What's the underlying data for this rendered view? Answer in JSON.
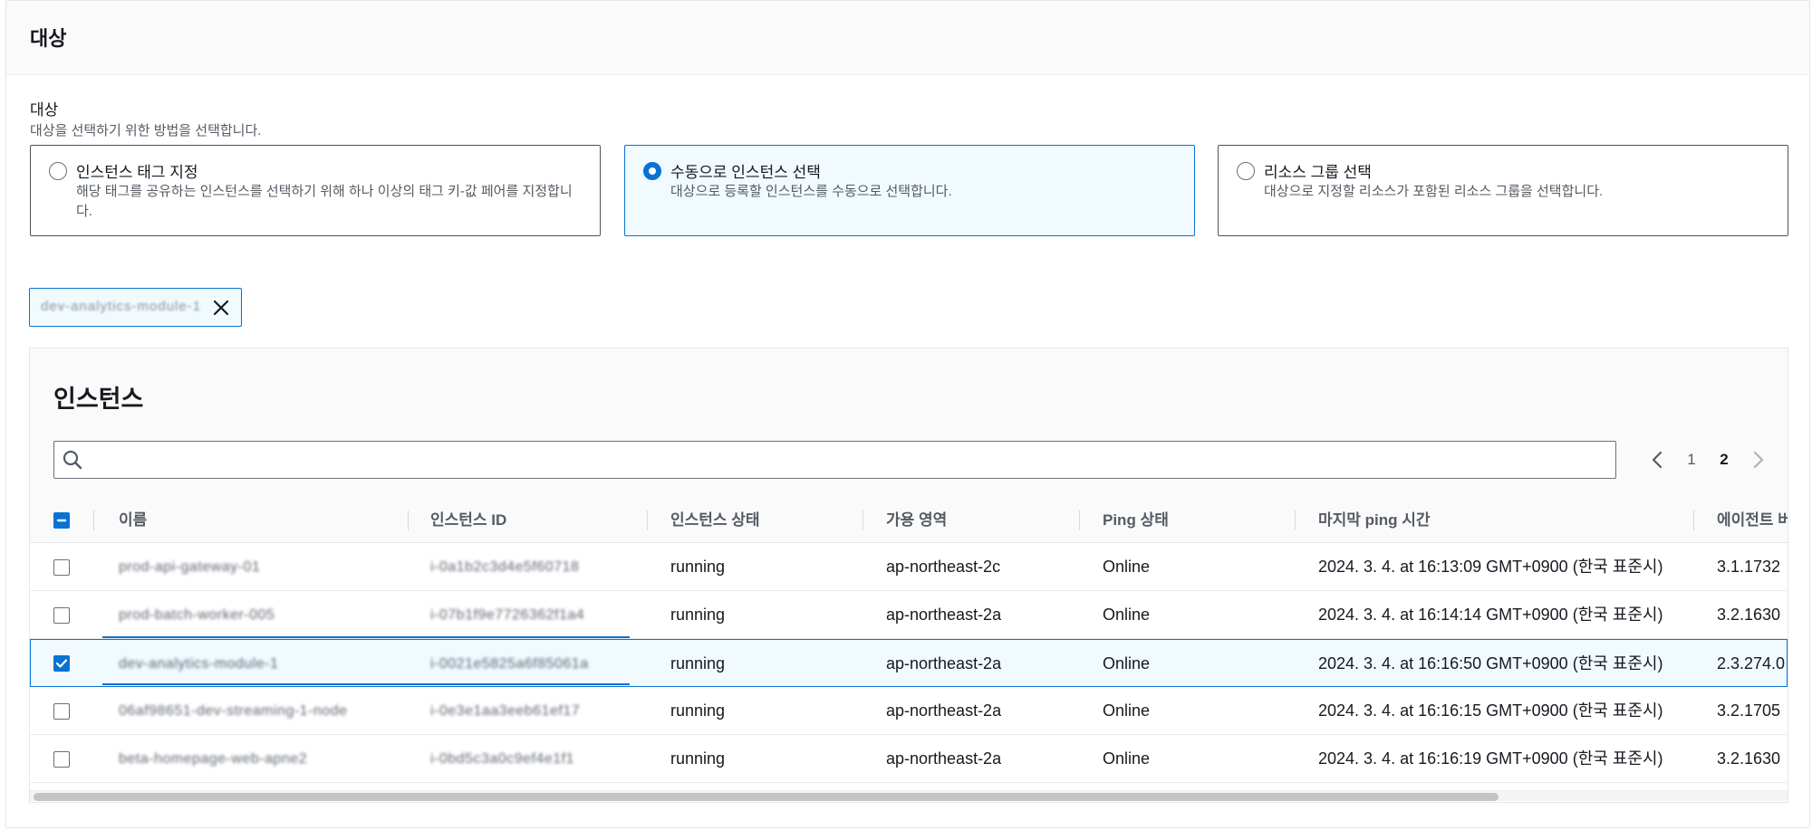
{
  "section": {
    "title": "대상",
    "field_label": "대상",
    "field_desc": "대상을 선택하기 위한 방법을 선택합니다."
  },
  "tiles": [
    {
      "title": "인스턴스 태그 지정",
      "desc": "해당 태그를 공유하는 인스턴스를 선택하기 위해 하나 이상의 태그 키-값 페어를 지정합니다.",
      "selected": false
    },
    {
      "title": "수동으로 인스턴스 선택",
      "desc": "대상으로 등록할 인스턴스를 수동으로 선택합니다.",
      "selected": true
    },
    {
      "title": "리소스 그룹 선택",
      "desc": "대상으로 지정할 리소스가 포함된 리소스 그룹을 선택합니다.",
      "selected": false
    }
  ],
  "token": {
    "label": "dev-analytics-module-1"
  },
  "instances": {
    "title": "인스턴스",
    "search_placeholder": "",
    "pagination": {
      "pages": [
        "1",
        "2"
      ],
      "current": "2"
    },
    "columns": [
      "이름",
      "인스턴스 ID",
      "인스턴스 상태",
      "가용 영역",
      "Ping 상태",
      "마지막 ping 시간",
      "에이전트 버전"
    ],
    "rows": [
      {
        "name": "prod-api-gateway-01",
        "id": "i-0a1b2c3d4e5f60718",
        "state": "running",
        "az": "ap-northeast-2c",
        "ping": "Online",
        "last_ping": "2024. 3. 4. at 16:13:09 GMT+0900 (한국 표준시)",
        "agent": "3.1.1732",
        "checked": false
      },
      {
        "name": "prod-batch-worker-005",
        "id": "i-07b1f9e7726362f1a4",
        "state": "running",
        "az": "ap-northeast-2a",
        "ping": "Online",
        "last_ping": "2024. 3. 4. at 16:14:14 GMT+0900 (한국 표준시)",
        "agent": "3.2.1630",
        "checked": false
      },
      {
        "name": "dev-analytics-module-1",
        "id": "i-0021e5825a6f85061a",
        "state": "running",
        "az": "ap-northeast-2a",
        "ping": "Online",
        "last_ping": "2024. 3. 4. at 16:16:50 GMT+0900 (한국 표준시)",
        "agent": "2.3.274.0",
        "checked": true
      },
      {
        "name": "06af98651-dev-streaming-1-node",
        "id": "i-0e3e1aa3eeb61ef17",
        "state": "running",
        "az": "ap-northeast-2a",
        "ping": "Online",
        "last_ping": "2024. 3. 4. at 16:16:15 GMT+0900 (한국 표준시)",
        "agent": "3.2.1705",
        "checked": false
      },
      {
        "name": "beta-homepage-web-apne2",
        "id": "i-0bd5c3a0c9ef4e1f1",
        "state": "running",
        "az": "ap-northeast-2a",
        "ping": "Online",
        "last_ping": "2024. 3. 4. at 16:16:19 GMT+0900 (한국 표준시)",
        "agent": "3.2.1630",
        "checked": false
      }
    ]
  },
  "colors": {
    "accent": "#0972d3",
    "selected_bg": "#f1faff",
    "header_bg": "#fafafa",
    "text_primary": "#16191f",
    "text_secondary": "#545b64"
  },
  "icons": {
    "search": "search-icon",
    "close": "close-icon",
    "prev": "chevron-left-icon",
    "next": "chevron-right-icon",
    "check": "check-icon",
    "minus": "minus-icon"
  }
}
